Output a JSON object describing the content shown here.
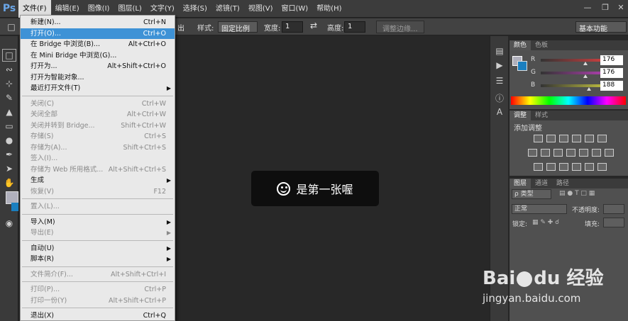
{
  "app": {
    "logo": "Ps"
  },
  "menubar": {
    "items": [
      "文件(F)",
      "编辑(E)",
      "图像(I)",
      "图层(L)",
      "文字(Y)",
      "选择(S)",
      "滤镜(T)",
      "视图(V)",
      "窗口(W)",
      "帮助(H)"
    ],
    "active_index": 0,
    "window_controls": [
      "minimize-icon",
      "restore-icon",
      "close-icon"
    ]
  },
  "options_bar": {
    "partial_label": "出",
    "style_label": "样式:",
    "style_value": "固定比例",
    "width_label": "宽度:",
    "width_value": "1",
    "height_label": "高度:",
    "height_value": "1",
    "refine_edge_button": "调整边缘...",
    "workspace_value": "基本功能"
  },
  "file_menu": {
    "items": [
      {
        "label": "新建(N)...",
        "shortcut": "Ctrl+N",
        "state": "enabled"
      },
      {
        "label": "打开(O)...",
        "shortcut": "Ctrl+O",
        "state": "selected"
      },
      {
        "label": "在 Bridge 中浏览(B)...",
        "shortcut": "Alt+Ctrl+O",
        "state": "enabled"
      },
      {
        "label": "在 Mini Bridge 中浏览(G)...",
        "shortcut": "",
        "state": "enabled"
      },
      {
        "label": "打开为...",
        "shortcut": "Alt+Shift+Ctrl+O",
        "state": "enabled"
      },
      {
        "label": "打开为智能对象...",
        "shortcut": "",
        "state": "enabled"
      },
      {
        "label": "最近打开文件(T)",
        "shortcut": "",
        "state": "enabled",
        "submenu": true
      },
      {
        "separator": true
      },
      {
        "label": "关闭(C)",
        "shortcut": "Ctrl+W",
        "state": "disabled"
      },
      {
        "label": "关闭全部",
        "shortcut": "Alt+Ctrl+W",
        "state": "disabled"
      },
      {
        "label": "关闭并转到 Bridge...",
        "shortcut": "Shift+Ctrl+W",
        "state": "disabled"
      },
      {
        "label": "存储(S)",
        "shortcut": "Ctrl+S",
        "state": "disabled"
      },
      {
        "label": "存储为(A)...",
        "shortcut": "Shift+Ctrl+S",
        "state": "disabled"
      },
      {
        "label": "签入(I)...",
        "shortcut": "",
        "state": "disabled"
      },
      {
        "label": "存储为 Web 所用格式...",
        "shortcut": "Alt+Shift+Ctrl+S",
        "state": "disabled"
      },
      {
        "label": "生成",
        "shortcut": "",
        "state": "enabled",
        "submenu": true
      },
      {
        "label": "恢复(V)",
        "shortcut": "F12",
        "state": "disabled"
      },
      {
        "separator": true
      },
      {
        "label": "置入(L)...",
        "shortcut": "",
        "state": "disabled"
      },
      {
        "separator": true
      },
      {
        "label": "导入(M)",
        "shortcut": "",
        "state": "enabled",
        "submenu": true
      },
      {
        "label": "导出(E)",
        "shortcut": "",
        "state": "disabled",
        "submenu": true
      },
      {
        "separator": true
      },
      {
        "label": "自动(U)",
        "shortcut": "",
        "state": "enabled",
        "submenu": true
      },
      {
        "label": "脚本(R)",
        "shortcut": "",
        "state": "enabled",
        "submenu": true
      },
      {
        "separator": true
      },
      {
        "label": "文件简介(F)...",
        "shortcut": "Alt+Shift+Ctrl+I",
        "state": "disabled"
      },
      {
        "separator": true
      },
      {
        "label": "打印(P)...",
        "shortcut": "Ctrl+P",
        "state": "disabled"
      },
      {
        "label": "打印一份(Y)",
        "shortcut": "Alt+Shift+Ctrl+P",
        "state": "disabled"
      },
      {
        "separator": true
      },
      {
        "label": "退出(X)",
        "shortcut": "Ctrl+Q",
        "state": "enabled"
      }
    ]
  },
  "toast": {
    "text": "是第一张喔",
    "icon": "smiley-icon"
  },
  "color_panel": {
    "tabs": [
      "颜色",
      "色板"
    ],
    "active_tab": 0,
    "sliders": [
      {
        "label": "R",
        "value": "176",
        "level": 0.69,
        "color": "#d04040"
      },
      {
        "label": "G",
        "value": "176",
        "level": 0.69,
        "color": "#b040b0"
      },
      {
        "label": "B",
        "value": "188",
        "level": 0.74,
        "color": "#c0c040"
      }
    ],
    "foreground_color": "#b0b0bc",
    "background_color": "#1a7fc0"
  },
  "adjust_panel": {
    "tabs": [
      "调整",
      "样式"
    ],
    "active_tab": 0,
    "title": "添加调整"
  },
  "layers_panel": {
    "tabs": [
      "图层",
      "通道",
      "路径"
    ],
    "active_tab": 0,
    "kind_filter": "ρ 类型",
    "blend_mode": "正常",
    "opacity_label": "不透明度:",
    "lock_label": "锁定:",
    "fill_label": "填充:"
  },
  "watermark": {
    "brand": "Bai",
    "brand_suffix": "du",
    "product": "经验",
    "url": "jingyan.baidu.com"
  }
}
